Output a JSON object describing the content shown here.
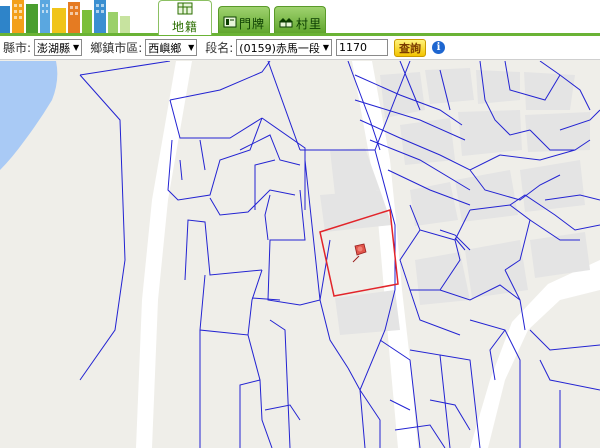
{
  "tabs": [
    {
      "id": "cadastre",
      "label": "地籍",
      "active": true,
      "icon": "map-grid-icon"
    },
    {
      "id": "doorplate",
      "label": "門牌",
      "active": false,
      "icon": "doorplate-icon"
    },
    {
      "id": "village",
      "label": "村里",
      "active": false,
      "icon": "houses-icon"
    }
  ],
  "toolbar": {
    "county_label": "縣市:",
    "county_value": "澎湖縣",
    "township_label": "鄉鎮市區:",
    "township_value": "西嶼鄉",
    "section_label": "段名:",
    "section_value": "(0159)赤馬一段",
    "lot_value": "1170",
    "search_label": "查詢",
    "info_label": "i"
  },
  "map": {
    "parcel_line_color": "#2323d2",
    "selected_parcel_color": "#e2242a",
    "water_color": "#a9caf5",
    "road_color": "#ffffff",
    "building_color": "#e6e6e6",
    "background_color": "#efeee9",
    "marker_icon": "pushpin-icon"
  }
}
